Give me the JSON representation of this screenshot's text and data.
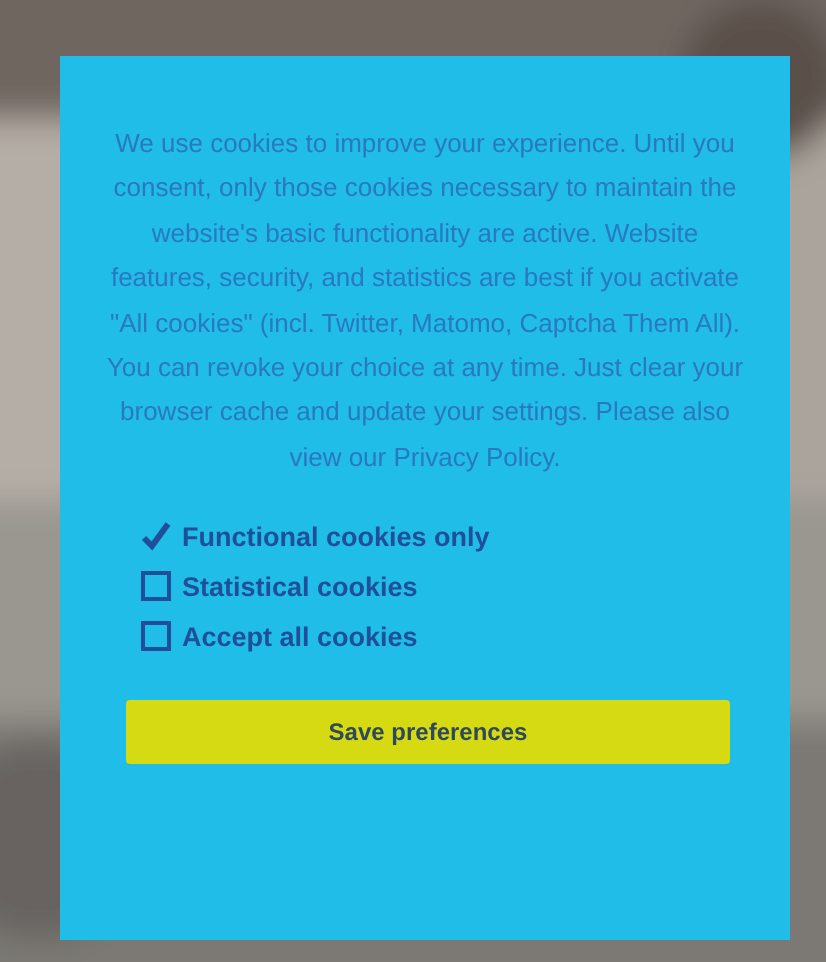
{
  "dialog": {
    "message": "We use cookies to improve your experience. Until you consent, only those cookies necessary to maintain the website's basic functionality are active. Website features, security, and statistics are best if you activate \"All cookies\" (incl. Twitter, Matomo, Captcha Them All). You can revoke your choice at any time. Just clear your browser cache and update your settings. Please also view our",
    "link": "Privacy Policy.",
    "options": [
      {
        "label": "Functional cookies only",
        "checked": true
      },
      {
        "label": "Statistical cookies",
        "checked": false
      },
      {
        "label": "Accept all cookies",
        "checked": false
      }
    ],
    "button": "Save preferences"
  }
}
